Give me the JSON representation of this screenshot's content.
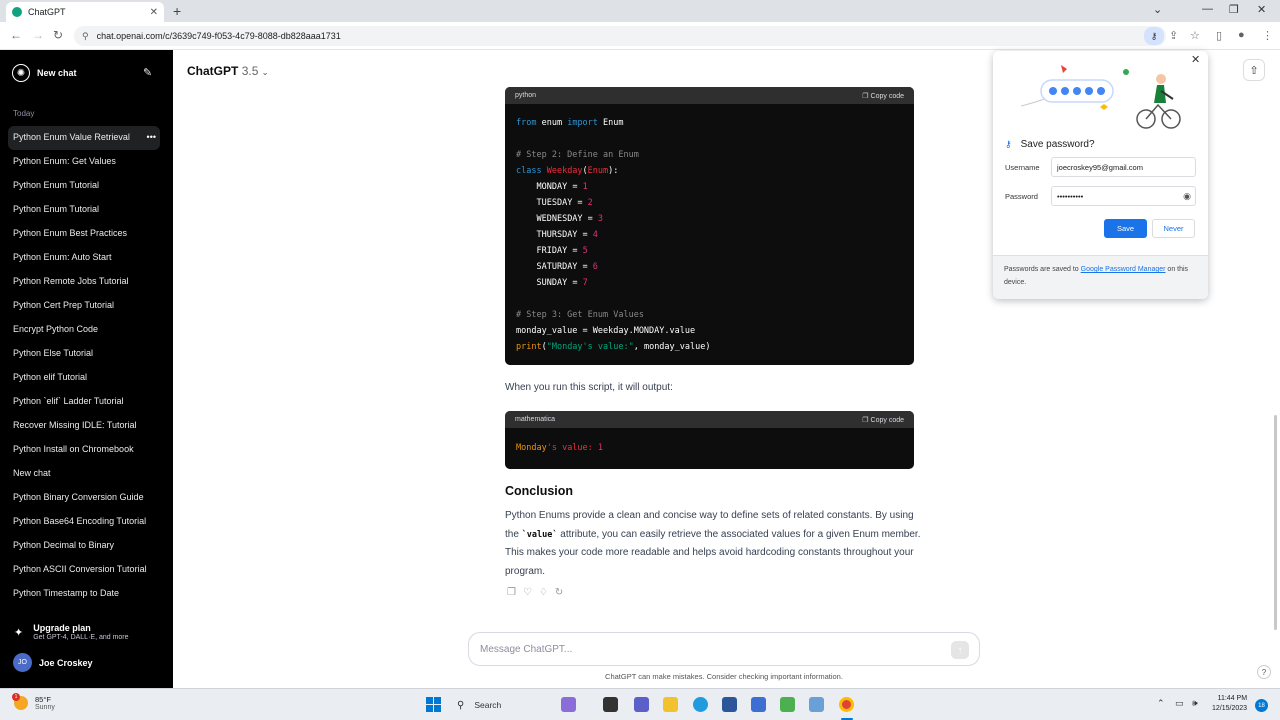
{
  "browser": {
    "tab_title": "ChatGPT",
    "tab_close": "✕",
    "new_tab": "+",
    "url": "chat.openai.com/c/3639c749-f053-4c79-8088-db828aaa1731"
  },
  "sidebar": {
    "new_chat": "New chat",
    "section_today": "Today",
    "items": [
      {
        "label": "Python Enum Value Retrieval"
      },
      {
        "label": "Python Enum: Get Values"
      },
      {
        "label": "Python Enum Tutorial"
      },
      {
        "label": "Python Enum Tutorial"
      },
      {
        "label": "Python Enum Best Practices"
      },
      {
        "label": "Python Enum: Auto Start"
      },
      {
        "label": "Python Remote Jobs Tutorial"
      },
      {
        "label": "Python Cert Prep Tutorial"
      },
      {
        "label": "Encrypt Python Code"
      },
      {
        "label": "Python Else Tutorial"
      },
      {
        "label": "Python elif Tutorial"
      },
      {
        "label": "Python `elif` Ladder Tutorial"
      },
      {
        "label": "Recover Missing IDLE: Tutorial"
      },
      {
        "label": "Python Install on Chromebook"
      },
      {
        "label": "New chat"
      },
      {
        "label": "Python Binary Conversion Guide"
      },
      {
        "label": "Python Base64 Encoding Tutorial"
      },
      {
        "label": "Python Decimal to Binary"
      },
      {
        "label": "Python ASCII Conversion Tutorial"
      },
      {
        "label": "Python Timestamp to Date"
      }
    ],
    "upgrade_title": "Upgrade plan",
    "upgrade_sub": "Get GPT-4, DALL·E, and more",
    "user_initials": "JO",
    "user_name": "Joe Croskey"
  },
  "header": {
    "model": "ChatGPT",
    "version": "3.5"
  },
  "code1": {
    "lang": "python",
    "copy": "Copy code",
    "l1_kw": "from",
    "l1_mod": " enum ",
    "l1_kw2": "import",
    "l1_name": " Enum",
    "comment1": "# Step 2: Define an Enum",
    "cls_kw": "class",
    "cls_name": "Weekday",
    "cls_base": "Enum",
    "members": [
      {
        "name": "MONDAY",
        "value": "1"
      },
      {
        "name": "TUESDAY",
        "value": "2"
      },
      {
        "name": "WEDNESDAY",
        "value": "3"
      },
      {
        "name": "THURSDAY",
        "value": "4"
      },
      {
        "name": "FRIDAY",
        "value": "5"
      },
      {
        "name": "SATURDAY",
        "value": "6"
      },
      {
        "name": "SUNDAY",
        "value": "7"
      }
    ],
    "comment2": "# Step 3: Get Enum Values",
    "assign": "monday_value = Weekday.MONDAY.value",
    "print_fn": "print",
    "print_str": "\"Monday's value:\"",
    "print_arg": ", monday_value)"
  },
  "output_intro": "When you run this script, it will output:",
  "code2": {
    "lang": "mathematica",
    "copy": "Copy code",
    "out_a": "Monday",
    "out_b": "'s value: ",
    "out_c": "1"
  },
  "conclusion": {
    "heading": "Conclusion",
    "p1": "Python Enums provide a clean and concise way to define sets of related constants. By using the ",
    "code": "`value`",
    "p2": " attribute, you can easily retrieve the associated values for a given Enum member. This makes your code more readable and helps avoid hardcoding constants throughout your program."
  },
  "composer": {
    "placeholder": "Message ChatGPT...",
    "disclaimer": "ChatGPT can make mistakes. Consider checking important information.",
    "help": "?"
  },
  "password_popup": {
    "title": "Save password?",
    "username_label": "Username",
    "username_value": "joecroskey95@gmail.com",
    "password_label": "Password",
    "password_value": "••••••••••",
    "save": "Save",
    "never": "Never",
    "footer_pre": "Passwords are saved to ",
    "footer_link": "Google Password Manager",
    "footer_post": " on this device."
  },
  "taskbar": {
    "temp": "85°F",
    "condition": "Sunny",
    "weather_badge": "1",
    "search": "Search",
    "time": "11:44 PM",
    "date": "12/15/2023",
    "notif_count": "18"
  },
  "colors": {
    "sidebar_bg": "#000000",
    "accent_blue": "#1a73e8",
    "code_bg": "#0d0d0d",
    "keyword": "#2e95d3",
    "number": "#df3079",
    "class_name": "#f22c3d",
    "string": "#00a67d"
  }
}
